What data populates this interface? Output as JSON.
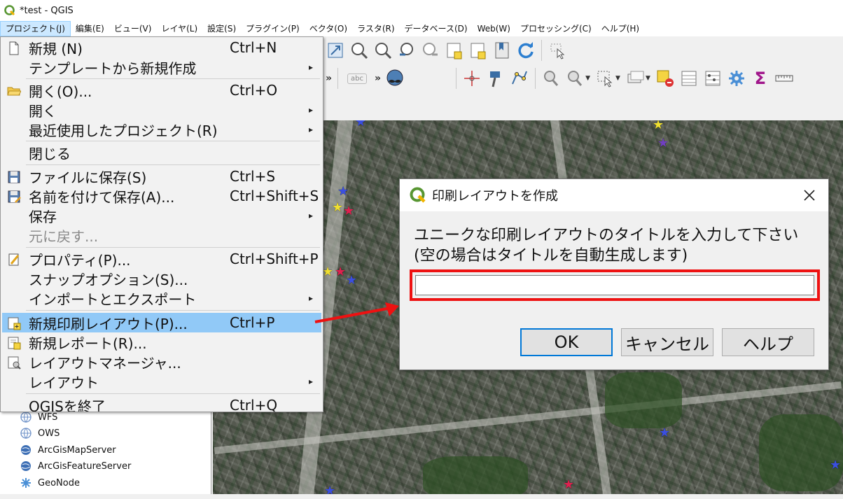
{
  "window": {
    "title": "*test - QGIS"
  },
  "menubar": [
    {
      "label": "プロジェクト(J)",
      "active": true
    },
    {
      "label": "編集(E)"
    },
    {
      "label": "ビュー(V)"
    },
    {
      "label": "レイヤ(L)"
    },
    {
      "label": "設定(S)"
    },
    {
      "label": "プラグイン(P)"
    },
    {
      "label": "ベクタ(O)"
    },
    {
      "label": "ラスタ(R)"
    },
    {
      "label": "データベース(D)"
    },
    {
      "label": "Web(W)"
    },
    {
      "label": "プロセッシング(C)"
    },
    {
      "label": "ヘルプ(H)"
    }
  ],
  "project_menu": {
    "items": [
      {
        "label": "新規 (N)",
        "shortcut": "Ctrl+N",
        "icon": "new-file-icon"
      },
      {
        "label": "テンプレートから新規作成",
        "submenu": "▸"
      },
      {
        "label": "開く(O)...",
        "shortcut": "Ctrl+O",
        "icon": "folder-open-icon"
      },
      {
        "label": "開く",
        "submenu": "▸"
      },
      {
        "label": "最近使用したプロジェクト(R)",
        "submenu": "▸"
      },
      {
        "label": "閉じる"
      },
      {
        "label": "ファイルに保存(S)",
        "shortcut": "Ctrl+S",
        "icon": "save-icon"
      },
      {
        "label": "名前を付けて保存(A)...",
        "shortcut": "Ctrl+Shift+S",
        "icon": "save-as-icon"
      },
      {
        "label": "保存",
        "submenu": "▸"
      },
      {
        "label": "元に戻す...",
        "disabled": true
      },
      {
        "label": "プロパティ(P)...",
        "shortcut": "Ctrl+Shift+P",
        "icon": "properties-icon"
      },
      {
        "label": "スナップオプション(S)..."
      },
      {
        "label": "インポートとエクスポート",
        "submenu": "▸"
      },
      {
        "label": "新規印刷レイアウト(P)...",
        "shortcut": "Ctrl+P",
        "icon": "new-print-layout-icon",
        "highlight": true
      },
      {
        "label": "新規レポート(R)...",
        "icon": "new-report-icon"
      },
      {
        "label": "レイアウトマネージャ...",
        "icon": "layout-manager-icon"
      },
      {
        "label": "レイアウト",
        "submenu": "▸"
      },
      {
        "label": "QGISを終了",
        "shortcut": "Ctrl+Q"
      }
    ]
  },
  "browser_panel": {
    "items": [
      {
        "label": "WFS",
        "icon": "wfs-globe-icon"
      },
      {
        "label": "OWS",
        "icon": "ows-globe-icon"
      },
      {
        "label": "ArcGisMapServer",
        "icon": "arcgis-map-server-icon"
      },
      {
        "label": "ArcGisFeatureServer",
        "icon": "arcgis-feature-server-icon"
      },
      {
        "label": "GeoNode",
        "icon": "geonode-icon"
      }
    ]
  },
  "toolbar": {
    "chevron": "»",
    "abc_label": "abc",
    "sigma": "Σ"
  },
  "dialog": {
    "title": "印刷レイアウトを作成",
    "close": "✕",
    "message_line1": "ユニークな印刷レイアウトのタイトルを入力して下さい",
    "message_line2": "(空の場合はタイトルを自動生成します)",
    "input_value": "",
    "ok_label": "OK",
    "cancel_label": "キャンセル",
    "help_label": "ヘルプ"
  },
  "colors": {
    "menu_highlight": "#91c9f7",
    "annotation_red": "#ee1111",
    "qgis_green": "#589632"
  },
  "map_markers": {
    "star_glyph": "★"
  }
}
